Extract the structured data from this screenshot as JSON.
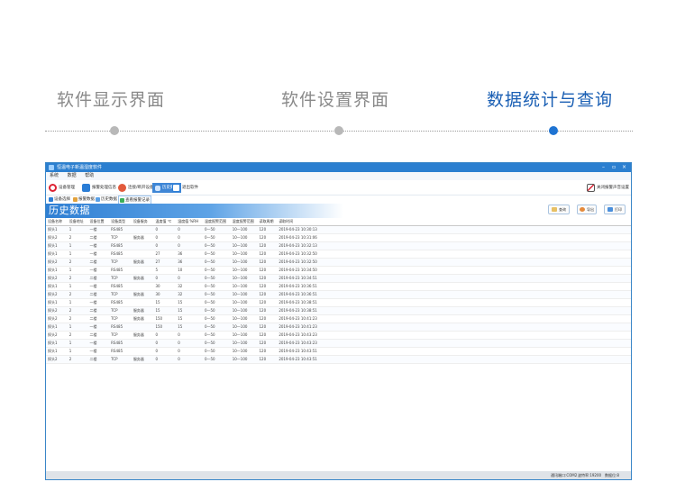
{
  "steps": {
    "display": "软件显示界面",
    "settings": "软件设置界面",
    "statistics": "数据统计与查询"
  },
  "colors": {
    "accent": "#1a5fb4",
    "window_border": "#3a86c8",
    "titlebar": "#2b7fd0"
  },
  "window": {
    "title": "恒温电子新温湿度软件",
    "controls": {
      "minimize": "–",
      "maximize": "▫",
      "close": "×"
    },
    "menu": [
      "系统",
      "数据",
      "帮助"
    ],
    "toolbar": {
      "device_manage": "设备管理",
      "alarm_handling": "报警处理信息",
      "connect_device": "连接/断开设备",
      "history": "历史数据",
      "exit": "退出软件",
      "mute": "关闭报警声音设置"
    },
    "subtoolbar": {
      "device_list": "设备选择",
      "alarm_data": "报警数据",
      "history_data": "历史数据",
      "alarm_log": "查看报警记录"
    },
    "page_title": "历史数据",
    "actions": {
      "query": "查询",
      "export_excel": "导出",
      "print": "打印"
    },
    "table": {
      "headers": [
        "设备名称",
        "设备地址",
        "设备位置",
        "设备类型",
        "设备服务",
        "温度值 ℃",
        "湿度值 %RH",
        "温度报警范围",
        "湿度报警范围",
        "读取周期",
        "读取时间"
      ],
      "rows": [
        [
          "探头1",
          "1",
          "一楼",
          "RS485",
          "",
          "0",
          "0",
          "0—50",
          "10—100",
          "120",
          "2019-04-23 10:30:13"
        ],
        [
          "探头2",
          "2",
          "二楼",
          "TCP",
          "服务器",
          "0",
          "0",
          "0—50",
          "10—100",
          "120",
          "2019-04-23 10:31:06"
        ],
        [
          "探头1",
          "1",
          "一楼",
          "RS485",
          "",
          "0",
          "0",
          "0—50",
          "10—100",
          "120",
          "2019-04-23 10:32:13"
        ],
        [
          "探头1",
          "1",
          "一楼",
          "RS485",
          "",
          "27",
          "36",
          "0—50",
          "10—100",
          "120",
          "2019-04-23 10:32:50"
        ],
        [
          "探头2",
          "2",
          "二楼",
          "TCP",
          "服务器",
          "27",
          "36",
          "0—50",
          "10—100",
          "120",
          "2019-04-23 10:32:50"
        ],
        [
          "探头1",
          "1",
          "一楼",
          "RS485",
          "",
          "5",
          "10",
          "0—50",
          "10—100",
          "120",
          "2019-04-23 10:34:50"
        ],
        [
          "探头2",
          "2",
          "二楼",
          "TCP",
          "服务器",
          "0",
          "0",
          "0—50",
          "10—100",
          "120",
          "2019-04-23 10:34:51"
        ],
        [
          "探头1",
          "1",
          "一楼",
          "RS485",
          "",
          "30",
          "32",
          "0—50",
          "10—100",
          "120",
          "2019-04-23 10:36:51"
        ],
        [
          "探头2",
          "2",
          "二楼",
          "TCP",
          "服务器",
          "30",
          "32",
          "0—50",
          "10—100",
          "120",
          "2019-04-23 10:36:51"
        ],
        [
          "探头1",
          "1",
          "一楼",
          "RS485",
          "",
          "15",
          "15",
          "0—50",
          "10—100",
          "120",
          "2019-04-23 10:38:51"
        ],
        [
          "探头2",
          "2",
          "二楼",
          "TCP",
          "服务器",
          "15",
          "15",
          "0—50",
          "10—100",
          "120",
          "2019-04-23 10:38:51"
        ],
        [
          "探头2",
          "2",
          "二楼",
          "TCP",
          "服务器",
          "150",
          "15",
          "0—50",
          "10—100",
          "120",
          "2019-04-23 10:41:23"
        ],
        [
          "探头1",
          "1",
          "一楼",
          "RS485",
          "",
          "150",
          "15",
          "0—50",
          "10—100",
          "120",
          "2019-04-23 10:41:23"
        ],
        [
          "探头2",
          "2",
          "二楼",
          "TCP",
          "服务器",
          "0",
          "0",
          "0—50",
          "10—100",
          "120",
          "2019-04-23 10:43:23"
        ],
        [
          "探头1",
          "1",
          "一楼",
          "RS485",
          "",
          "0",
          "0",
          "0—50",
          "10—100",
          "120",
          "2019-04-23 10:43:23"
        ],
        [
          "探头1",
          "1",
          "一楼",
          "RS485",
          "",
          "0",
          "0",
          "0—50",
          "10—100",
          "120",
          "2019-04-23 10:43:51"
        ],
        [
          "探头2",
          "2",
          "二楼",
          "TCP",
          "服务器",
          "0",
          "0",
          "0—50",
          "10—100",
          "120",
          "2019-04-23 10:43:51"
        ]
      ]
    },
    "status": {
      "port": "通讯端口:COM2",
      "baud": "波特率:19200",
      "data_bits": "数据位:8"
    }
  }
}
